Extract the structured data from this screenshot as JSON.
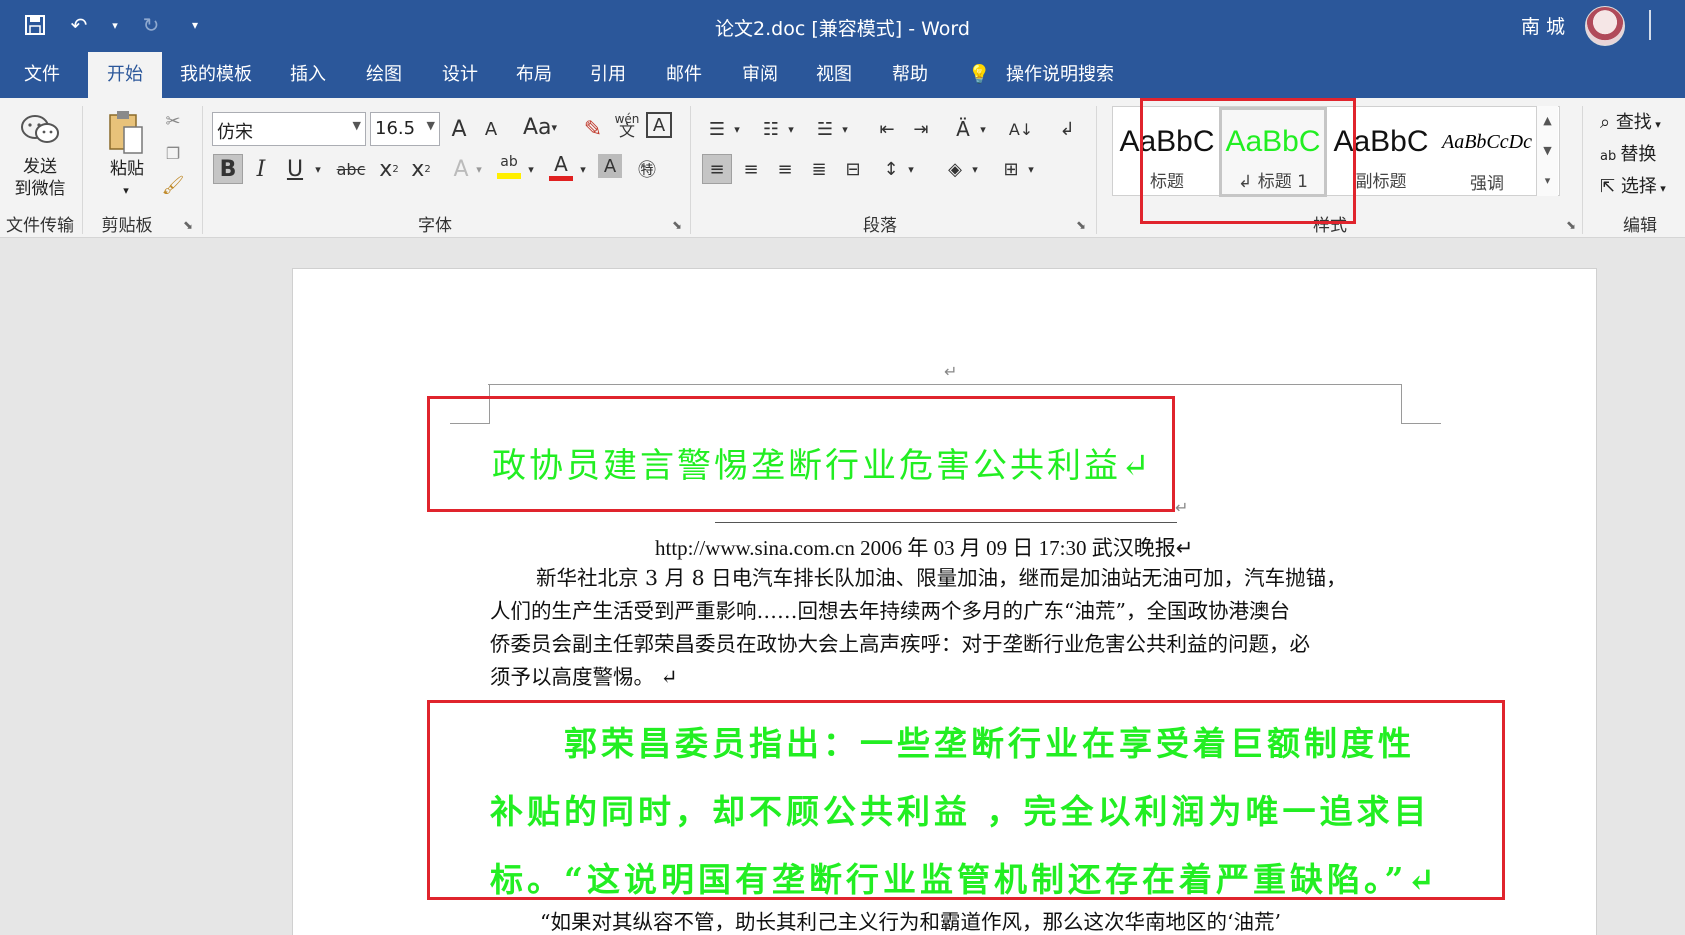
{
  "window": {
    "title": "论文2.doc [兼容模式]  -  Word",
    "user": "南 城"
  },
  "qat": {
    "save_icon": "save-icon",
    "undo_icon": "undo-icon",
    "redo_icon": "redo-icon",
    "customize_icon": "customize-qat-icon"
  },
  "tabs": [
    {
      "label": "文件"
    },
    {
      "label": "开始"
    },
    {
      "label": "我的模板"
    },
    {
      "label": "插入"
    },
    {
      "label": "绘图"
    },
    {
      "label": "设计"
    },
    {
      "label": "布局"
    },
    {
      "label": "引用"
    },
    {
      "label": "邮件"
    },
    {
      "label": "审阅"
    },
    {
      "label": "视图"
    },
    {
      "label": "帮助"
    }
  ],
  "tell_me": "操作说明搜索",
  "ribbon": {
    "wechat": {
      "label_line1": "发送",
      "label_line2": "到微信",
      "group": "文件传输"
    },
    "clipboard": {
      "paste": "粘贴",
      "group": "剪贴板"
    },
    "font": {
      "name": "仿宋",
      "size": "16.5",
      "group": "字体",
      "case_label": "Aa",
      "grow": "A",
      "shrink": "A",
      "wen": "wén",
      "wen_char": "文",
      "bold": "B",
      "italic": "I",
      "underline": "U",
      "strike": "abc",
      "sub": "x",
      "sup": "x",
      "font_color": "A",
      "highlight": "ab"
    },
    "paragraph": {
      "group": "段落"
    },
    "styles": {
      "group": "样式",
      "items": [
        {
          "sample": "AaBbC",
          "name": "标题"
        },
        {
          "sample": "AaBbC",
          "name": "↲ 标题 1"
        },
        {
          "sample": "AaBbC",
          "name": "副标题"
        },
        {
          "sample": "AaBbCcDc",
          "name": "强调"
        }
      ]
    },
    "editing": {
      "find": "查找",
      "replace": "替换",
      "select": "选择",
      "group": "编辑"
    }
  },
  "document": {
    "return_mark": "↵",
    "title": "政协员建言警惕垄断行业危害公共利益↵",
    "source": "http://www.sina.com.cn 2006 年 03 月 09 日 17:30  武汉晚报↵",
    "paragraph1": [
      "新华社北京 3 月 8 日电汽车排长队加油、限量加油，继而是加油站无油可加，汽车抛锚，",
      "人们的生产生活受到严重影响……回想去年持续两个多月的广东“油荒”，全国政协港澳台",
      "侨委员会副主任郭荣昌委员在政协大会上高声疾呼：对于垄断行业危害公共利益的问题，必",
      "须予以高度警惕。 ↵"
    ],
    "paragraph2": [
      "　　郭荣昌委员指出：一些垄断行业在享受着巨额制度性",
      "补贴的同时，却不顾公共利益 ，完全以利润为唯一追求目",
      "标。“这说明国有垄断行业监管机制还存在着严重缺陷。”↵"
    ],
    "paragraph3": "“如果对其纵容不管，助长其利己主义行为和霸道作风，那么这次华南地区的‘油荒’"
  },
  "colors": {
    "accent": "#2b579a",
    "highlight_red": "#e0242d",
    "green_text": "#22ee22"
  }
}
